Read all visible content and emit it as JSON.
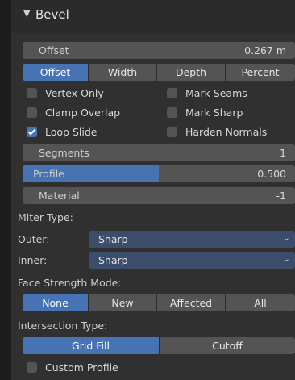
{
  "panel": {
    "title": "Bevel",
    "offset_field": {
      "label": "Offset",
      "value": "0.267 m"
    },
    "width_type": {
      "options": [
        "Offset",
        "Width",
        "Depth",
        "Percent"
      ],
      "selected": "Offset"
    },
    "checkboxes_left": [
      {
        "label": "Vertex Only",
        "checked": false
      },
      {
        "label": "Clamp Overlap",
        "checked": false
      },
      {
        "label": "Loop Slide",
        "checked": true
      }
    ],
    "checkboxes_right": [
      {
        "label": "Mark Seams",
        "checked": false
      },
      {
        "label": "Mark Sharp",
        "checked": false
      },
      {
        "label": "Harden Normals",
        "checked": false
      }
    ],
    "segments_field": {
      "label": "Segments",
      "value": "1"
    },
    "profile_field": {
      "label": "Profile",
      "value": "0.500",
      "fill_fraction": 0.5
    },
    "material_field": {
      "label": "Material",
      "value": "-1"
    },
    "miter_type_label": "Miter Type:",
    "outer": {
      "label": "Outer:",
      "value": "Sharp"
    },
    "inner": {
      "label": "Inner:",
      "value": "Sharp"
    },
    "face_strength_label": "Face Strength Mode:",
    "face_strength": {
      "options": [
        "None",
        "New",
        "Affected",
        "All"
      ],
      "selected": "None"
    },
    "intersection_label": "Intersection Type:",
    "intersection": {
      "options": [
        "Grid Fill",
        "Cutoff"
      ],
      "selected": "Grid Fill"
    },
    "custom_profile": {
      "label": "Custom Profile",
      "checked": false
    }
  },
  "colors": {
    "accent": "#4772b3",
    "field": "#545454",
    "dropdown": "#3b4d6a",
    "panel": "#303030"
  }
}
